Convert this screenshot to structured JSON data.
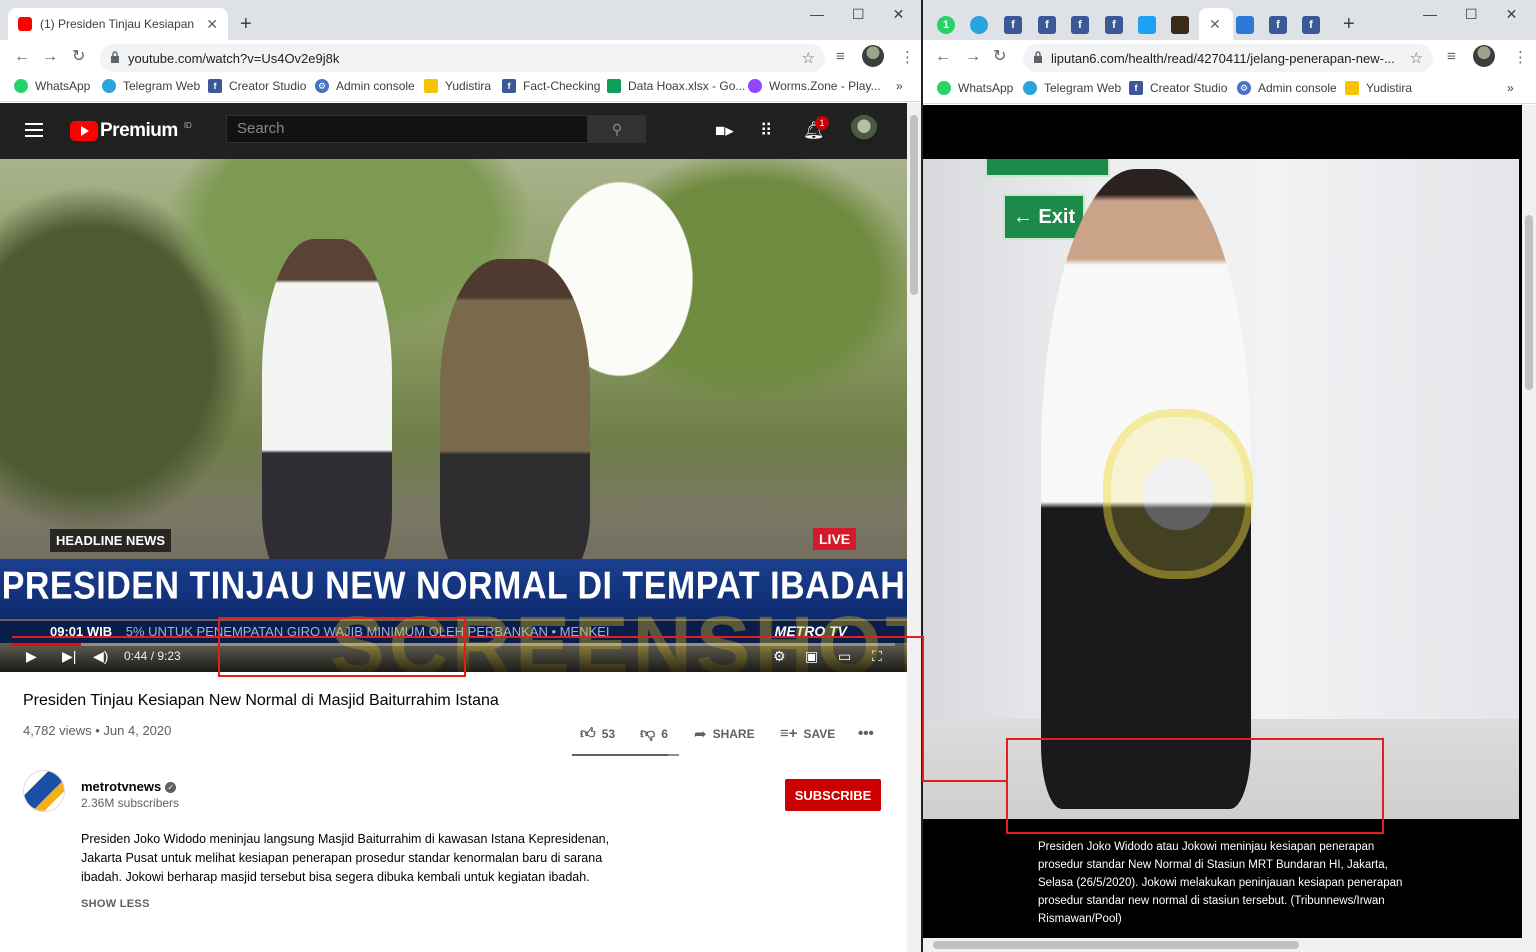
{
  "left": {
    "tab": {
      "title": "(1) Presiden Tinjau Kesiapan New Normal di Masjid Baiturrahim Istana",
      "close": "✕"
    },
    "url": "youtube.com/watch?v=Us4Ov2e9j8k",
    "bookmarks": [
      "WhatsApp",
      "Telegram Web",
      "Creator Studio",
      "Admin console",
      "Yudistira",
      "Fact-Checking",
      "Data Hoax.xlsx - Go...",
      "Worms.Zone - Play..."
    ],
    "more": "»",
    "yt": {
      "logo": "Premium",
      "country": "ID",
      "search_placeholder": "Search",
      "notif_count": "1"
    },
    "video": {
      "headline_tag": "HEADLINE NEWS",
      "live": "LIVE",
      "headline": "PRESIDEN TINJAU NEW NORMAL DI TEMPAT IBADAH",
      "ticker_time": "09:01 WIB",
      "ticker_text": "5% UNTUK PENEMPATAN GIRO WAJIB MINIMUM OLEH PERBANKAN  •  MENKEI",
      "brand": "METRO TV",
      "timecode": "0:44 / 9:23",
      "progress": 0.078,
      "watermark": "SCREENSHOT BY"
    },
    "title": "Presiden Tinjau Kesiapan New Normal di Masjid Baiturrahim Istana",
    "meta": "4,782 views • Jun 4, 2020",
    "likes": "53",
    "dislikes": "6",
    "share": "SHARE",
    "save": "SAVE",
    "like_ratio": 0.9,
    "channel": {
      "name": "metrotvnews",
      "subs": "2.36M subscribers",
      "subscribe": "SUBSCRIBE"
    },
    "description": "Presiden Joko Widodo meninjau langsung Masjid Baiturrahim di kawasan Istana Kepresidenan, Jakarta Pusat untuk melihat kesiapan penerapan prosedur standar kenormalan baru di sarana ibadah. Jokowi berharap masjid tersebut bisa segera dibuka kembali untuk kegiatan ibadah.",
    "show_less": "SHOW LESS"
  },
  "right": {
    "tab_close": "✕",
    "url": "liputan6.com/health/read/4270411/jelang-penerapan-new-...",
    "bookmarks": [
      "WhatsApp",
      "Telegram Web",
      "Creator Studio",
      "Admin console",
      "Yudistira"
    ],
    "more": "»",
    "exit_sign": "← Exit",
    "caption": "Presiden Joko Widodo atau Jokowi meninjau kesiapan penerapan prosedur standar New Normal di Stasiun MRT Bundaran HI, Jakarta, Selasa (26/5/2020). Jokowi melakukan peninjauan kesiapan penerapan prosedur standar new normal di stasiun tersebut. (Tribunnews/Irwan Rismawan/Pool)"
  },
  "colors": {
    "youtube_red": "#ff0000",
    "subscribe": "#cc0000",
    "annotation": "#e02020"
  }
}
